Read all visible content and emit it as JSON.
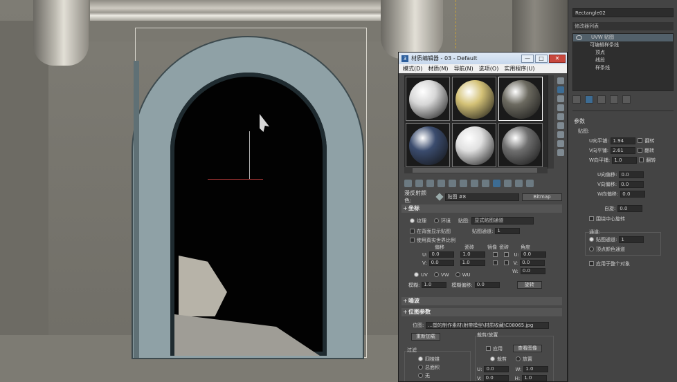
{
  "command_panel": {
    "object_name": "Rectangle02",
    "modifier_list_label": "修改器列表",
    "stack": [
      {
        "label": "UVW 贴图",
        "level": 1
      },
      {
        "label": "可编辑样条线",
        "level": 1
      },
      {
        "label": "顶点",
        "level": 2
      },
      {
        "label": "线段",
        "level": 2
      },
      {
        "label": "样条线",
        "level": 2
      }
    ],
    "params_title": "参数",
    "map_label": "贴图:",
    "tiling": [
      {
        "label": "U向平铺:",
        "value": "1.94",
        "flip": "翻转"
      },
      {
        "label": "V向平铺:",
        "value": "2.61",
        "flip": "翻转"
      },
      {
        "label": "W向平铺:",
        "value": "1.0",
        "flip": "翻转"
      }
    ],
    "offsets": [
      {
        "label": "U向偏移:",
        "value": "0.0"
      },
      {
        "label": "V向偏移:",
        "value": "0.0"
      },
      {
        "label": "W向偏移:",
        "value": "0.0"
      }
    ],
    "rotation_label": "自旋:",
    "rotation_value": "0.0",
    "rotate_center": "围绕中心旋转",
    "channel_title": "通道:",
    "map_channel_label": "贴图通道:",
    "map_channel_value": "1",
    "vertex_color_channel": "顶点颜色通道",
    "apply_whole": "应用于整个对象"
  },
  "material_editor": {
    "title": "材质编辑器 - 03 - Default",
    "app_icon": "3",
    "menus": [
      "模式(D)",
      "材质(M)",
      "导航(N)",
      "选项(O)",
      "实用程序(U)"
    ],
    "window_controls": [
      "—",
      "□",
      "✕"
    ],
    "samples": [
      {
        "name": "white-sphere",
        "color": "#d7d7d7",
        "selected": false
      },
      {
        "name": "yellow-sphere",
        "color": "#d4c277",
        "selected": false
      },
      {
        "name": "stone-sphere",
        "color": "#6c6a60",
        "selected": true
      },
      {
        "name": "blue-tile-sphere",
        "color": "#3b4c6e",
        "selected": false
      },
      {
        "name": "white-sphere-2",
        "color": "#e0e0e0",
        "selected": false
      },
      {
        "name": "grey-sphere",
        "color": "#6f6f6f",
        "selected": false
      }
    ],
    "diffuse_label": "漫反射颜色:",
    "map_name": "贴图 #8",
    "map_type": "Bitmap",
    "coords": {
      "title": "坐标",
      "texture": "纹理",
      "environ": "环境",
      "mapping_label": "贴图:",
      "mapping_value": "显式贴图通道",
      "show_on_back": "在背面显示贴图",
      "use_real_world": "使用真实世界比例",
      "map_channel_label": "贴图通道:",
      "map_channel_value": "1",
      "col_offset": "偏移",
      "col_tiling": "瓷砖",
      "col_mirror": "镜像",
      "col_tile": "瓷砖",
      "col_angle": "角度",
      "u_label": "U:",
      "v_label": "V:",
      "w_label": "W:",
      "u_offset": "0.0",
      "v_offset": "0.0",
      "u_tiling": "1.0",
      "v_tiling": "1.0",
      "u_angle": "0.0",
      "v_angle": "0.0",
      "w_angle": "0.0",
      "uv": "UV",
      "vw": "VW",
      "wu": "WU",
      "blur_label": "模糊:",
      "blur_value": "1.0",
      "blur_offset_label": "模糊偏移:",
      "blur_offset_value": "0.0",
      "rotate_btn": "旋转"
    },
    "noise_title": "噪波",
    "bitmap_title": "位图参数",
    "bitmap_label": "位图:",
    "bitmap_path": "...塑的制作素材\\附带模型\\材质收藏\\C08065.jpg",
    "reload_btn": "重新加载",
    "crop_title": "裁剪/放置",
    "apply_label": "应用",
    "view_image_btn": "查看图像",
    "crop_label": "裁剪",
    "place_label": "放置",
    "filter_title": "过滤",
    "filter_options": [
      "四棱锥",
      "总面积",
      "无"
    ],
    "crop_u_label": "U:",
    "crop_u_value": "0.0",
    "crop_w_label": "W:",
    "crop_w_value": "1.0",
    "crop_v_label": "V:",
    "crop_v_value": "0.0",
    "crop_h_label": "H:",
    "crop_h_value": "1.0"
  }
}
